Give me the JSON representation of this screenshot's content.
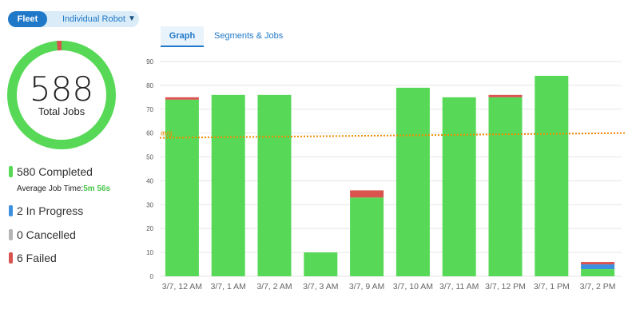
{
  "toggle": {
    "fleet_label": "Fleet",
    "individual_label": "Individual Robot",
    "caret": "▼"
  },
  "tabs": [
    {
      "label": "Graph"
    },
    {
      "label": "Segments & Jobs"
    }
  ],
  "summary": {
    "total": "588",
    "total_label": "Total Jobs",
    "completed_fraction": 0.986,
    "legend": [
      {
        "label": "580 Completed",
        "color": "#57d957"
      },
      {
        "label": "2 In Progress",
        "color": "#3d8fe0"
      },
      {
        "label": "0 Cancelled",
        "color": "#b5b5b5"
      },
      {
        "label": "6 Failed",
        "color": "#d9534f"
      }
    ],
    "avg_job_time_label": "Average Job Time:",
    "avg_job_time_value": "5m 56s"
  },
  "colors": {
    "completed": "#57d957",
    "in_progress": "#3d8fe0",
    "failed": "#d9534f",
    "avg_line": "#f08a00",
    "grid": "#e6e6e6"
  },
  "chart_data": {
    "type": "bar",
    "stacked": true,
    "categories": [
      "3/7, 12 AM",
      "3/7, 1 AM",
      "3/7, 2 AM",
      "3/7, 3 AM",
      "3/7, 9 AM",
      "3/7, 10 AM",
      "3/7, 11 AM",
      "3/7, 12 PM",
      "3/7, 1 PM",
      "3/7, 2 PM"
    ],
    "series": [
      {
        "key": "completed",
        "values": [
          74,
          76,
          76,
          10,
          33,
          79,
          75,
          75,
          84,
          3
        ]
      },
      {
        "key": "in_progress",
        "values": [
          0,
          0,
          0,
          0,
          0,
          0,
          0,
          0,
          0,
          2
        ]
      },
      {
        "key": "failed",
        "values": [
          1,
          0,
          0,
          0,
          3,
          0,
          0,
          1,
          0,
          1
        ]
      }
    ],
    "yticks": [
      0,
      10,
      20,
      30,
      40,
      50,
      60,
      70,
      80,
      90
    ],
    "ylim": [
      0,
      90
    ],
    "avg": {
      "label": "avg",
      "start": 58,
      "end": 60
    },
    "grid": true
  }
}
